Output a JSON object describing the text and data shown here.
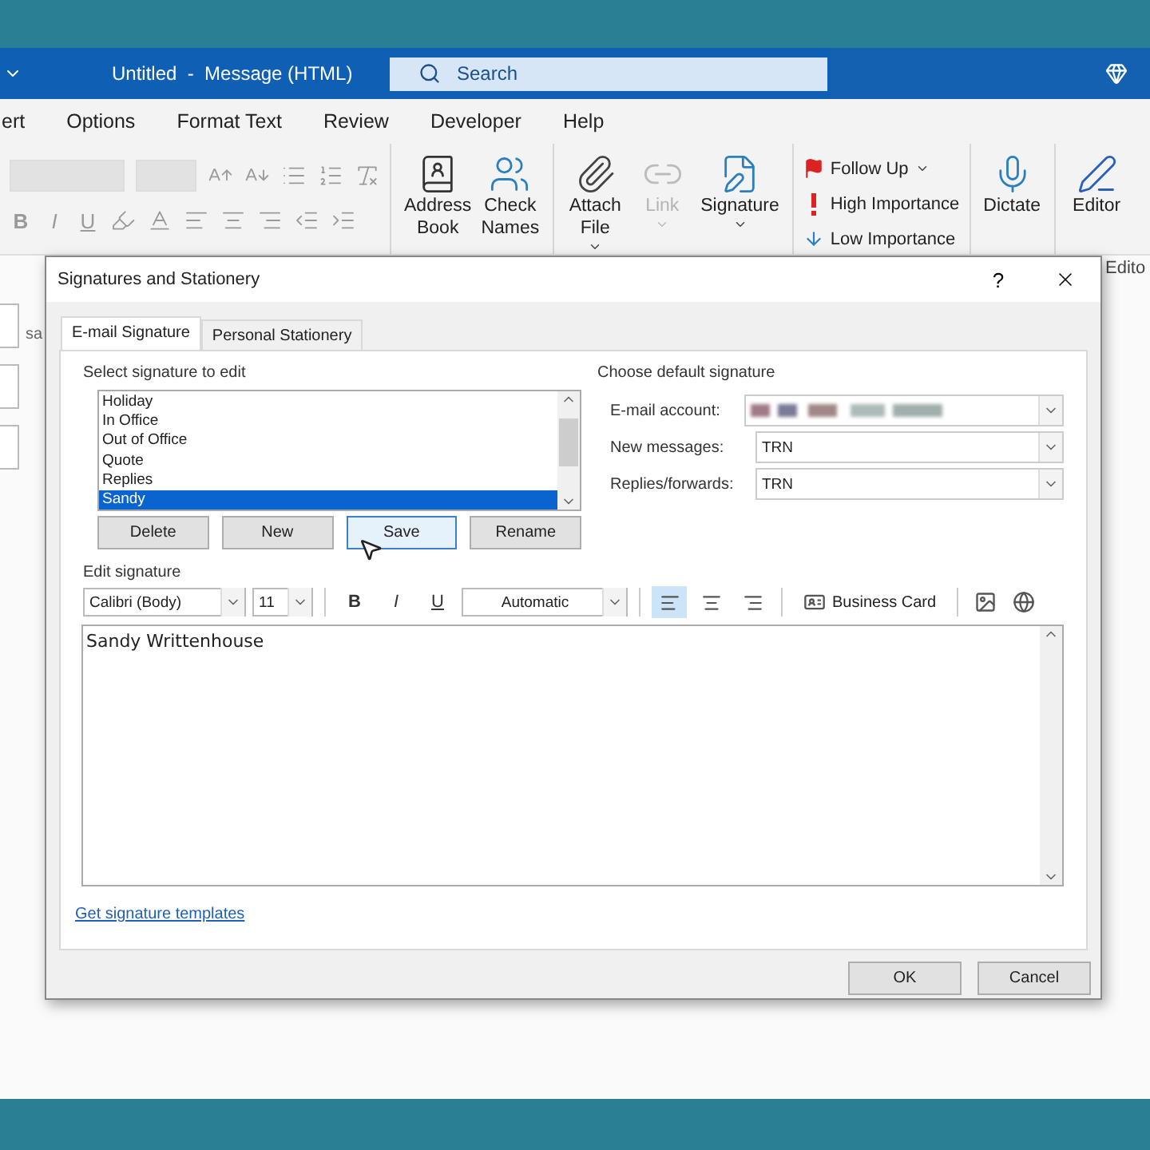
{
  "title_bar": {
    "title": "Untitled  -  Message (HTML)",
    "search_placeholder": "Search"
  },
  "menu_tabs": [
    "ert",
    "Options",
    "Format Text",
    "Review",
    "Developer",
    "Help"
  ],
  "ribbon": {
    "format_letters": [
      "B",
      "I",
      "U"
    ],
    "commands": [
      {
        "kind": "address",
        "label": "Address\nBook",
        "disabled": false,
        "caret": false
      },
      {
        "kind": "names",
        "label": "Check\nNames",
        "disabled": false,
        "caret": false
      },
      {
        "kind": "attach",
        "label": "Attach\nFile",
        "disabled": false,
        "caret": true
      },
      {
        "kind": "link",
        "label": "Link",
        "disabled": true,
        "caret": true
      },
      {
        "kind": "signature",
        "label": "Signature",
        "disabled": false,
        "caret": true
      }
    ],
    "tags": [
      {
        "kind": "flag",
        "label": "Follow Up",
        "caret": true
      },
      {
        "kind": "high",
        "label": "High Importance",
        "caret": false
      },
      {
        "kind": "low",
        "label": "Low Importance",
        "caret": false
      }
    ],
    "dictate": "Dictate",
    "editor": "Editor",
    "editor_group": "Edito"
  },
  "compose": {
    "field_text": "sa"
  },
  "dialog": {
    "title": "Signatures and Stationery",
    "help": "?",
    "tabs": [
      {
        "label": "E-mail Signature",
        "selected": true
      },
      {
        "label": "Personal Stationery",
        "selected": false
      }
    ],
    "select_label": "Select signature to edit",
    "signatures": [
      {
        "name": "Holiday",
        "selected": false
      },
      {
        "name": "In Office",
        "selected": false
      },
      {
        "name": "Out of Office",
        "selected": false
      },
      {
        "name": "Quote",
        "selected": false
      },
      {
        "name": "Replies",
        "selected": false
      },
      {
        "name": "Sandy",
        "selected": true
      }
    ],
    "buttons": [
      {
        "label": "Delete",
        "hovered": false
      },
      {
        "label": "New",
        "hovered": false
      },
      {
        "label": "Save",
        "hovered": true
      },
      {
        "label": "Rename",
        "hovered": false
      }
    ],
    "default_label": "Choose default signature",
    "account_label": "E-mail account:",
    "new_messages_label": "New messages:",
    "new_messages_value": "TRN",
    "replies_label": "Replies/forwards:",
    "replies_value": "TRN",
    "edit_label": "Edit signature",
    "font": "Calibri (Body)",
    "size": "11",
    "format_letters": [
      "B",
      "I",
      "U"
    ],
    "font_color": "Automatic",
    "align": [
      {
        "kind": "left",
        "selected": true
      },
      {
        "kind": "center",
        "selected": false
      },
      {
        "kind": "right",
        "selected": false
      }
    ],
    "business_card": "Business Card",
    "editor_text": "Sandy Writtenhouse",
    "templates_link": "Get signature templates",
    "ok": "OK",
    "cancel": "Cancel"
  }
}
